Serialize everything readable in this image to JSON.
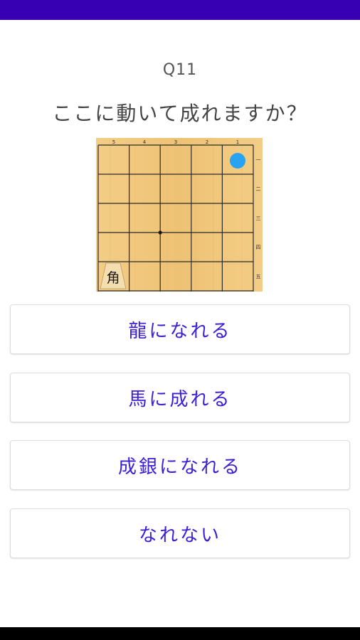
{
  "colors": {
    "status_bar": "#3700b3",
    "button_text": "#3a1fd6",
    "board_wood": "#f1c77b",
    "highlight_marker": "#27a3f2"
  },
  "quiz": {
    "number": "Q11",
    "prompt": "ここに動いて成れますか？"
  },
  "board": {
    "file_labels": [
      "5",
      "4",
      "3",
      "2",
      "1"
    ],
    "rank_labels": [
      "一",
      "二",
      "三",
      "四",
      "五"
    ],
    "pieces": [
      {
        "char": "角",
        "file": 5,
        "rank": 5
      }
    ],
    "highlight": {
      "file": 1,
      "rank": 1,
      "icon": "target-dot"
    },
    "star_points": [
      {
        "between_files": [
          4,
          3
        ],
        "between_ranks": [
          3,
          4
        ]
      }
    ]
  },
  "answers": [
    {
      "label": "龍になれる"
    },
    {
      "label": "馬に成れる"
    },
    {
      "label": "成銀になれる"
    },
    {
      "label": "なれない"
    }
  ]
}
